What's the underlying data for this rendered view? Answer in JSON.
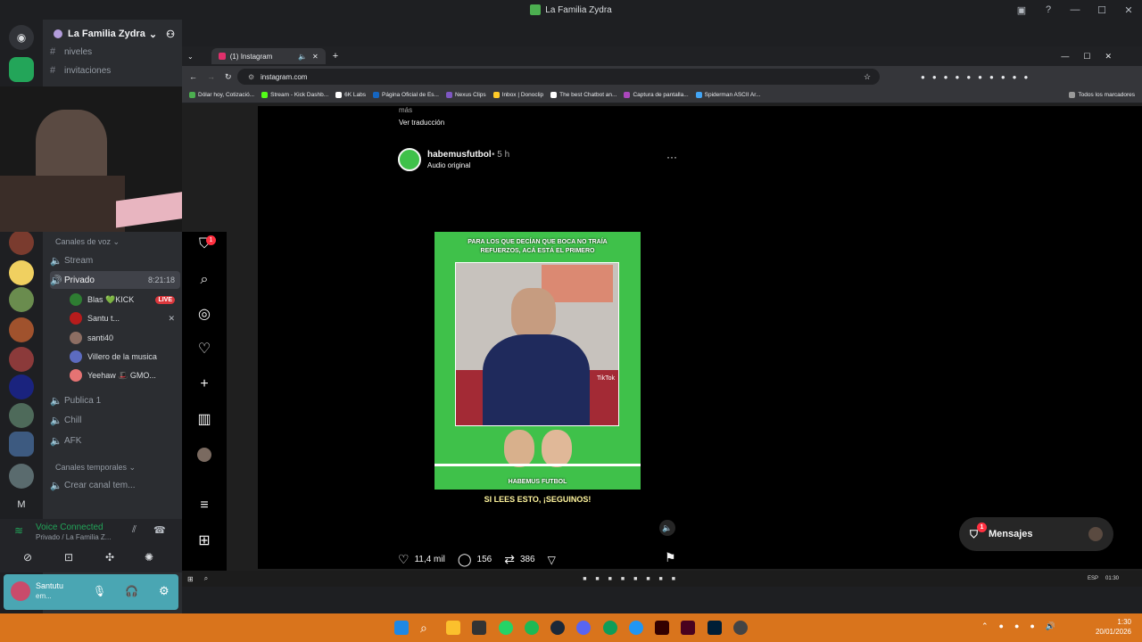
{
  "window": {
    "title": "La Familia Zydra",
    "controls": [
      "—",
      "☐",
      "✕"
    ]
  },
  "discord": {
    "server_name": "La Familia Zydra",
    "text_channels": [
      {
        "name": "niveles"
      },
      {
        "name": "invitaciones"
      }
    ],
    "voice_category": "Canales de voz",
    "voice_channels": [
      {
        "name": "Stream"
      },
      {
        "name": "Privado",
        "time": "8:21:18"
      }
    ],
    "privado_users": [
      {
        "name": "Blas 💚KICK",
        "live": "LIVE",
        "color": "#2e7d32"
      },
      {
        "name": "Santu t...",
        "color": "#b71c1c"
      },
      {
        "name": "santi40",
        "color": "#8d6e63"
      },
      {
        "name": "Villero de la musica",
        "color": "#5c6bc0"
      },
      {
        "name": "Yeehaw 🎩 GMO...",
        "color": "#e57373"
      }
    ],
    "other_voice_channels": [
      {
        "name": "Publica 1"
      },
      {
        "name": "Chill"
      },
      {
        "name": "AFK"
      }
    ],
    "temp_category": "Canales temporales",
    "temp_channels": [
      {
        "name": "Crear canal tem..."
      }
    ],
    "voice_status": {
      "title": "Voice Connected",
      "subtitle": "Privado / La Familia Z..."
    },
    "user": {
      "name": "Santutu",
      "status": "em..."
    }
  },
  "browser": {
    "tab_title": "(1) Instagram",
    "url": "instagram.com",
    "bookmarks": [
      {
        "label": "Dólar hoy, Cotizació...",
        "color": "#4caf50"
      },
      {
        "label": "Stream - Kick Dashb...",
        "color": "#53fc18"
      },
      {
        "label": "6K Labs",
        "color": "#ffffff"
      },
      {
        "label": "Página Oficial de Es...",
        "color": "#1565c0"
      },
      {
        "label": "Nexus Clips",
        "color": "#7e57c2"
      },
      {
        "label": "Inbox | Donoclip",
        "color": "#ffca28"
      },
      {
        "label": "The best Chatbot an...",
        "color": "#ffffff"
      },
      {
        "label": "Captura de pantalla...",
        "color": "#ab47bc"
      },
      {
        "label": "Spiderman ASCII Ar...",
        "color": "#42a5f5"
      }
    ],
    "bookmarks_all": "Todos los marcadores"
  },
  "instagram": {
    "prev_caption_more": "más",
    "translate_link": "Ver traducción",
    "post": {
      "username": "habemusfutbol",
      "age": "• 5 h",
      "audio": "Audio original",
      "thumb_top_text_line1": "PARA LOS QUE DECÍAN QUE BOCA NO TRAÍA",
      "thumb_top_text_line2": "REFUERZOS, ACÁ ESTÁ EL PRIMERO",
      "thumb_brand": "HABEMUS FUTBOL",
      "thumb_cta": "SI LEES ESTO, ¡SEGUINOS!",
      "tiktok_label": "TikTok",
      "likes": "11,4 mil",
      "comments": "156",
      "reposts": "386"
    },
    "notification_badge": "1",
    "messages_label": "Mensajes",
    "messages_badge": "1"
  },
  "inner_taskbar": {
    "lang": "ESP",
    "time": "01:30"
  },
  "taskbar": {
    "time": "1:30",
    "date": "20/01/2026",
    "app_colors": [
      "#1e88e5",
      "#ffffff",
      "#fbc02d",
      "#333333",
      "#25d366",
      "#1db954",
      "#1b2838",
      "#5865f2",
      "#0f9d58",
      "#2196f3",
      "#330000",
      "#49021f",
      "#001e36",
      "#444444"
    ]
  }
}
